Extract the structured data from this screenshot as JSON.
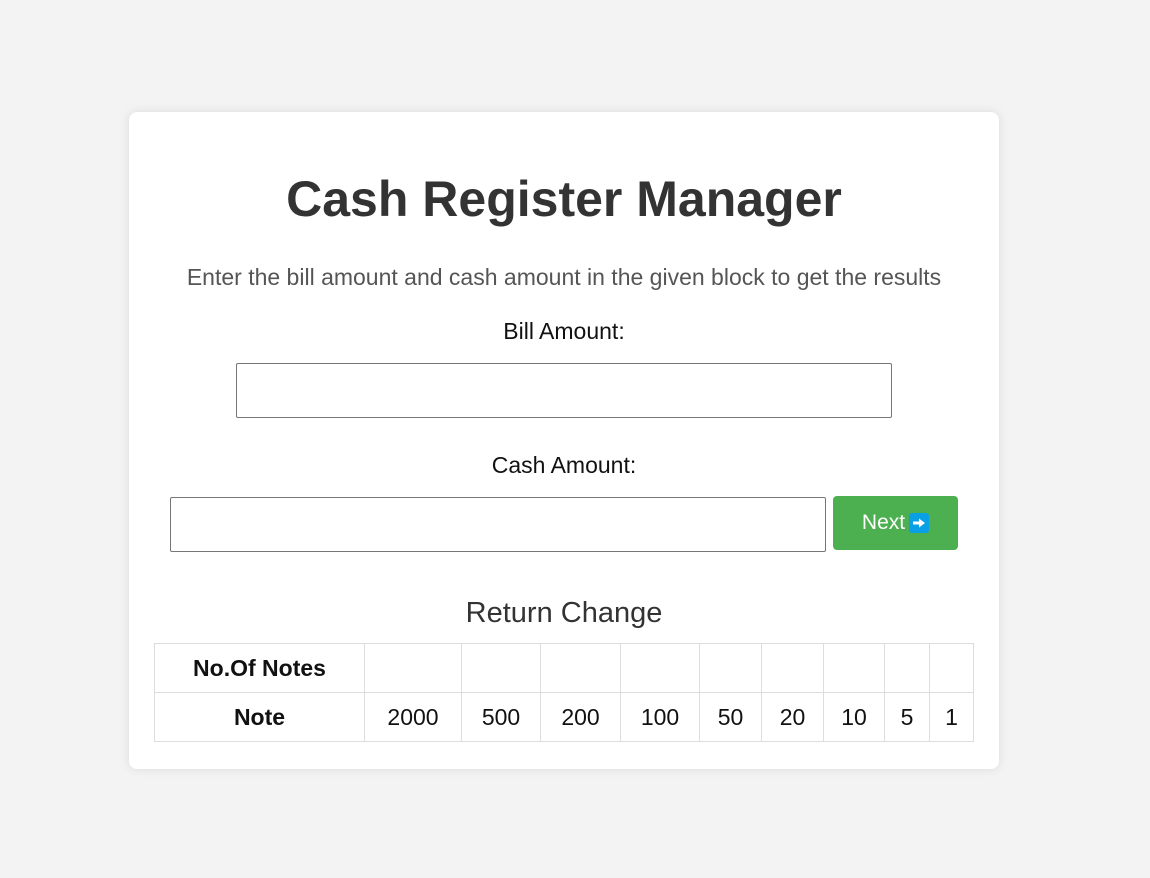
{
  "app": {
    "title": "Cash Register Manager",
    "subtitle": "Enter the bill amount and cash amount in the given block to get the results"
  },
  "form": {
    "bill_label": "Bill Amount:",
    "bill_value": "",
    "cash_label": "Cash Amount:",
    "cash_value": "",
    "next_label": "Next",
    "next_icon": "right-arrow-icon"
  },
  "result": {
    "title": "Return Change",
    "row_headers": [
      "No.Of Notes",
      "Note"
    ],
    "notes_count": [
      "",
      "",
      "",
      "",
      "",
      "",
      "",
      "",
      ""
    ],
    "notes": [
      "2000",
      "500",
      "200",
      "100",
      "50",
      "20",
      "10",
      "5",
      "1"
    ]
  },
  "colors": {
    "accent": "#4caf50",
    "background": "#f3f3f3",
    "card": "#ffffff"
  }
}
